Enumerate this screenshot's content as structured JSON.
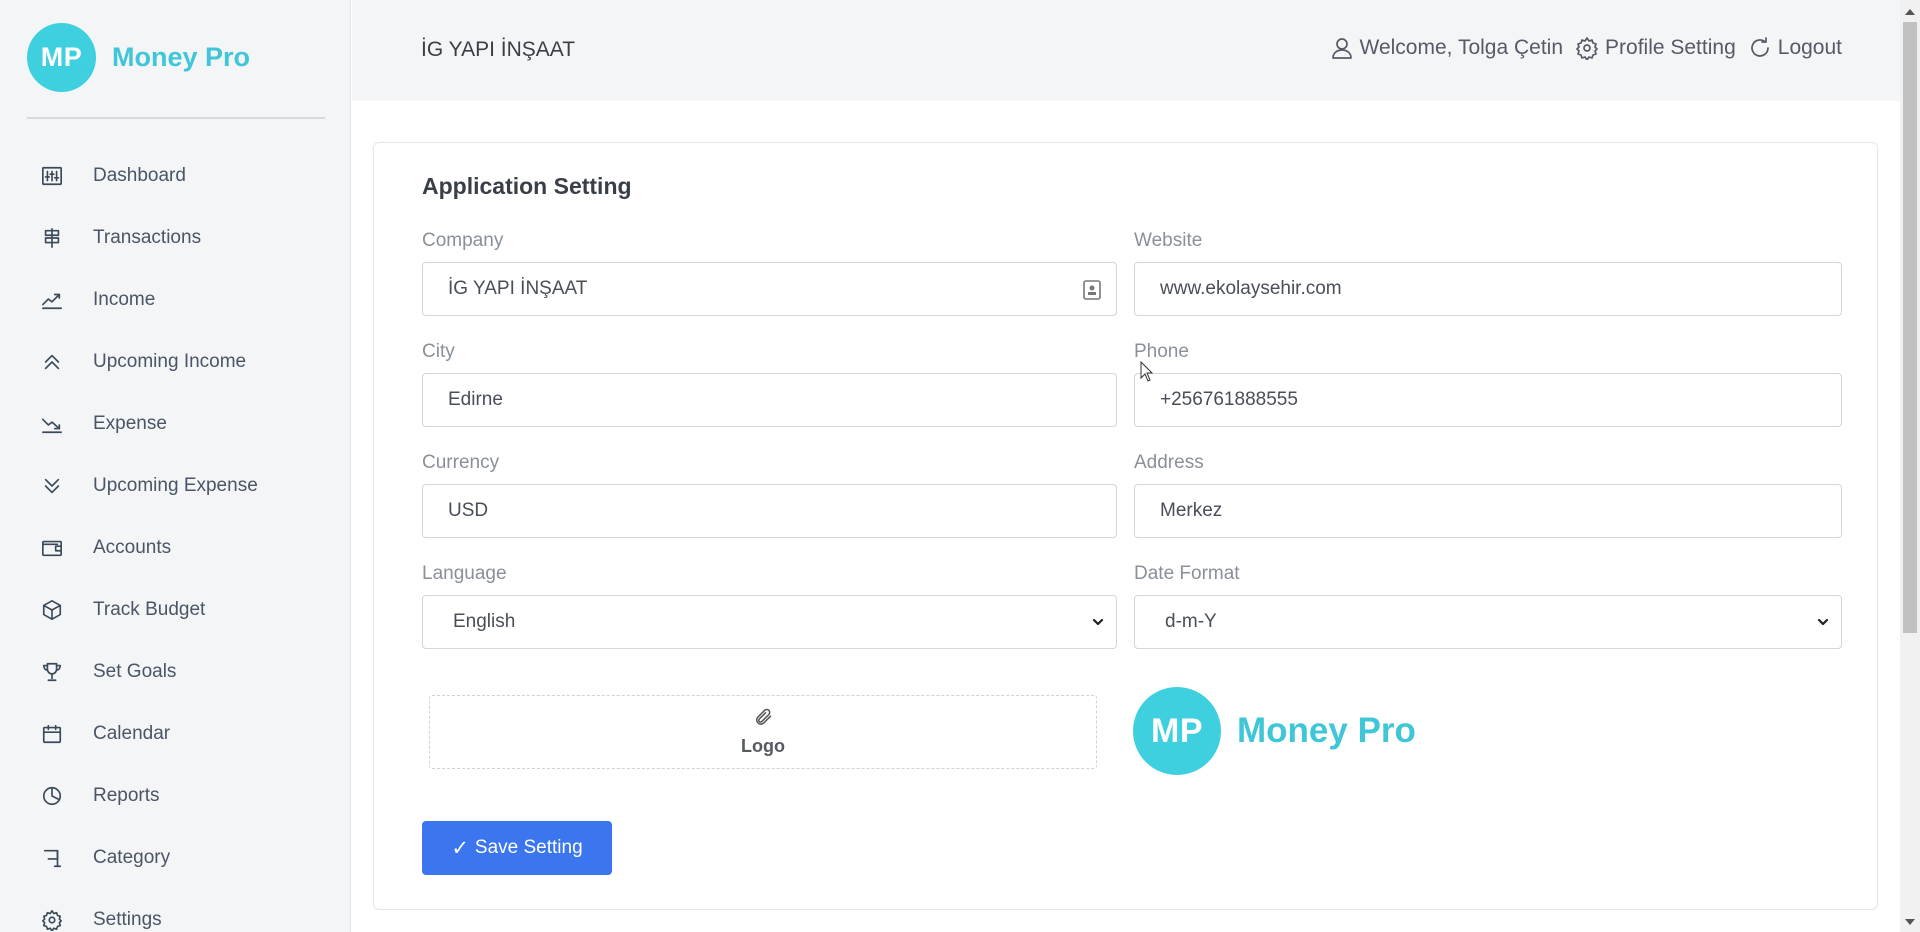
{
  "brand": {
    "initials": "MP",
    "name": "Money Pro",
    "color": "#3fd0e0"
  },
  "sidebar": {
    "items": [
      {
        "label": "Dashboard",
        "icon": "sliders-icon"
      },
      {
        "label": "Transactions",
        "icon": "signpost-icon"
      },
      {
        "label": "Income",
        "icon": "trend-up-icon"
      },
      {
        "label": "Upcoming Income",
        "icon": "double-chevron-up-icon"
      },
      {
        "label": "Expense",
        "icon": "trend-down-icon"
      },
      {
        "label": "Upcoming Expense",
        "icon": "double-chevron-down-icon"
      },
      {
        "label": "Accounts",
        "icon": "wallet-icon"
      },
      {
        "label": "Track Budget",
        "icon": "box-icon"
      },
      {
        "label": "Set Goals",
        "icon": "trophy-icon"
      },
      {
        "label": "Calendar",
        "icon": "calendar-icon"
      },
      {
        "label": "Reports",
        "icon": "pie-chart-icon"
      },
      {
        "label": "Category",
        "icon": "flag-icon"
      },
      {
        "label": "Settings",
        "icon": "gear-icon"
      }
    ]
  },
  "header": {
    "company": "İG YAPI İNŞAAT",
    "welcome": "Welcome, Tolga Çetin",
    "profile_setting": "Profile Setting",
    "logout": "Logout"
  },
  "settings": {
    "title": "Application Setting",
    "company": {
      "label": "Company",
      "value": "İG YAPI İNŞAAT"
    },
    "website": {
      "label": "Website",
      "value": "www.ekolaysehir.com"
    },
    "city": {
      "label": "City",
      "value": "Edirne"
    },
    "phone": {
      "label": "Phone",
      "value": "+256761888555"
    },
    "currency": {
      "label": "Currency",
      "value": "USD"
    },
    "address": {
      "label": "Address",
      "value": "Merkez"
    },
    "language": {
      "label": "Language",
      "value": "English"
    },
    "date_format": {
      "label": "Date Format",
      "value": "d-m-Y"
    },
    "logo_label": "Logo",
    "save_label": "Save Setting",
    "save_check": "✓"
  },
  "colors": {
    "accent": "#3b76ef",
    "brand": "#3fd0e0"
  }
}
